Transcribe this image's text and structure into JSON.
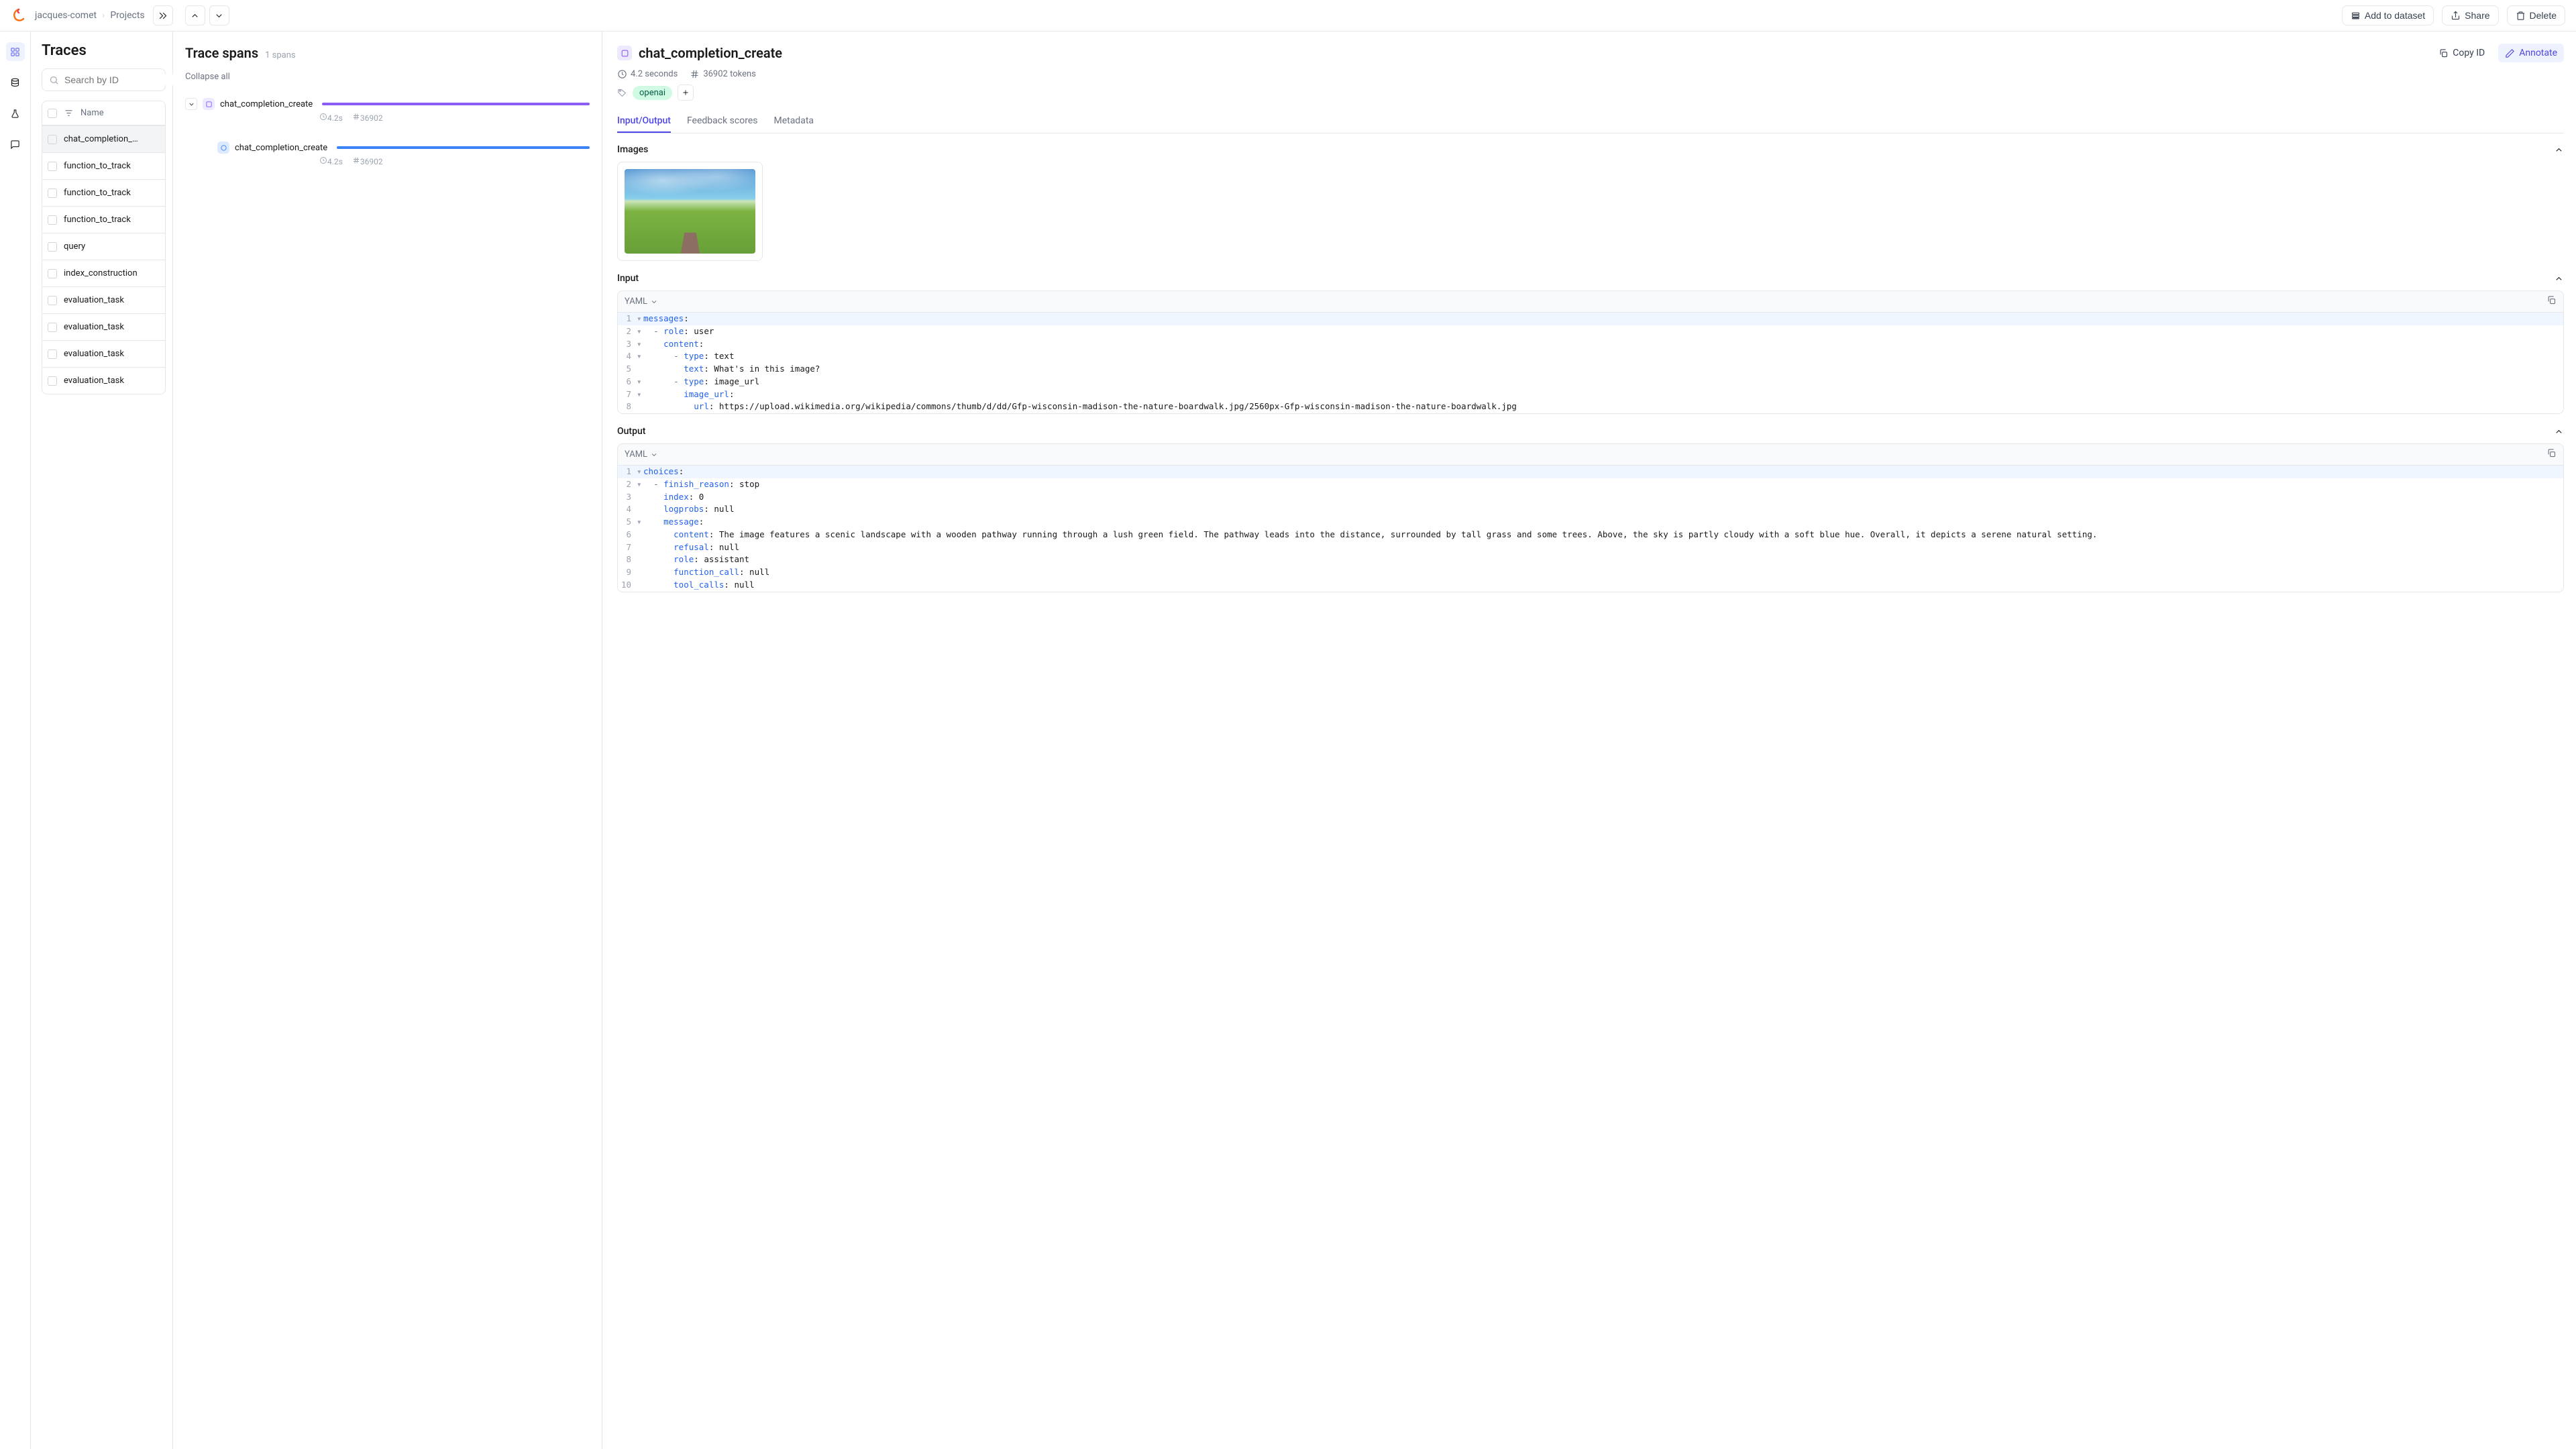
{
  "breadcrumb": {
    "owner": "jacques-comet",
    "section": "Projects"
  },
  "topbar": {
    "add_dataset": "Add to dataset",
    "share": "Share",
    "delete": "Delete"
  },
  "left": {
    "title": "Traces",
    "search_placeholder": "Search by ID",
    "name_col": "Name",
    "items": [
      "chat_completion_…",
      "function_to_track",
      "function_to_track",
      "function_to_track",
      "query",
      "index_construction",
      "evaluation_task",
      "evaluation_task",
      "evaluation_task",
      "evaluation_task"
    ]
  },
  "center": {
    "title": "Trace spans",
    "count_label": "1 spans",
    "collapse": "Collapse all",
    "spans": [
      {
        "name": "chat_completion_create",
        "duration": "4.2s",
        "tokens": "36902",
        "color": "purple"
      },
      {
        "name": "chat_completion_create",
        "duration": "4.2s",
        "tokens": "36902",
        "color": "blue"
      }
    ]
  },
  "right": {
    "title": "chat_completion_create",
    "copy_id": "Copy ID",
    "annotate": "Annotate",
    "duration": "4.2 seconds",
    "tokens": "36902 tokens",
    "tag": "openai",
    "tabs": {
      "io": "Input/Output",
      "feedback": "Feedback scores",
      "metadata": "Metadata"
    },
    "sections": {
      "images": "Images",
      "input": "Input",
      "output": "Output"
    },
    "format": "YAML",
    "input_code": {
      "l1": {
        "k": "messages",
        "r": ":"
      },
      "l2": {
        "d": "  - ",
        "k": "role",
        "r": ": user"
      },
      "l3": {
        "pad": "    ",
        "k": "content",
        "r": ":"
      },
      "l4": {
        "d": "      - ",
        "k": "type",
        "r": ": text"
      },
      "l5": {
        "pad": "        ",
        "k": "text",
        "r": ": What's in this image?"
      },
      "l6": {
        "d": "      - ",
        "k": "type",
        "r": ": image_url"
      },
      "l7": {
        "pad": "        ",
        "k": "image_url",
        "r": ":"
      },
      "l8": {
        "pad": "          ",
        "k": "url",
        "r": ": https://upload.wikimedia.org/wikipedia/commons/thumb/d/dd/Gfp-wisconsin-madison-the-nature-boardwalk.jpg/2560px-Gfp-wisconsin-madison-the-nature-boardwalk.jpg"
      }
    },
    "output_code": {
      "l1": {
        "k": "choices",
        "r": ":"
      },
      "l2": {
        "d": "  - ",
        "k": "finish_reason",
        "r": ": stop"
      },
      "l3": {
        "pad": "    ",
        "k": "index",
        "r": ": 0"
      },
      "l4": {
        "pad": "    ",
        "k": "logprobs",
        "r": ": null"
      },
      "l5": {
        "pad": "    ",
        "k": "message",
        "r": ":"
      },
      "l6": {
        "pad": "      ",
        "k": "content",
        "r": ": The image features a scenic landscape with a wooden pathway running through a lush green field. The pathway leads into the distance, surrounded by tall grass and some trees. Above, the sky is partly cloudy with a soft blue hue. Overall, it depicts a serene natural setting."
      },
      "l7": {
        "pad": "      ",
        "k": "refusal",
        "r": ": null"
      },
      "l8": {
        "pad": "      ",
        "k": "role",
        "r": ": assistant"
      },
      "l9": {
        "pad": "      ",
        "k": "function_call",
        "r": ": null"
      },
      "l10": {
        "pad": "      ",
        "k": "tool_calls",
        "r": ": null"
      }
    }
  }
}
